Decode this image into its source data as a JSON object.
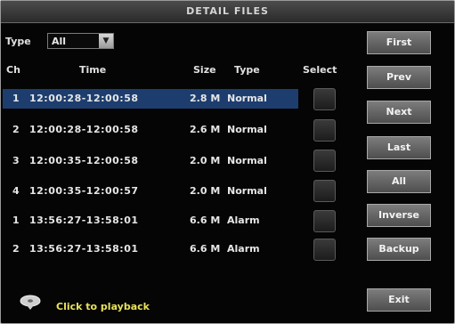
{
  "window": {
    "title": "DETAIL FILES"
  },
  "filter": {
    "type_label": "Type",
    "type_value": "All"
  },
  "table": {
    "headers": {
      "ch": "Ch",
      "time": "Time",
      "size": "Size",
      "type": "Type",
      "select": "Select"
    },
    "rows": [
      {
        "ch": "1",
        "time": "12:00:28-12:00:58",
        "size": "2.8 M",
        "type": "Normal",
        "selected": true
      },
      {
        "ch": "2",
        "time": "12:00:28-12:00:58",
        "size": "2.6 M",
        "type": "Normal",
        "selected": false
      },
      {
        "ch": "3",
        "time": "12:00:35-12:00:58",
        "size": "2.0 M",
        "type": "Normal",
        "selected": false
      },
      {
        "ch": "4",
        "time": "12:00:35-12:00:57",
        "size": "2.0 M",
        "type": "Normal",
        "selected": false
      },
      {
        "ch": "1",
        "time": "13:56:27-13:58:01",
        "size": "6.6 M",
        "type": "Alarm",
        "selected": false
      },
      {
        "ch": "2",
        "time": "13:56:27-13:58:01",
        "size": "6.6 M",
        "type": "Alarm",
        "selected": false
      }
    ]
  },
  "buttons": {
    "first": "First",
    "prev": "Prev",
    "next": "Next",
    "last": "Last",
    "all": "All",
    "inverse": "Inverse",
    "backup": "Backup",
    "exit": "Exit"
  },
  "footer": {
    "hint": "Click to playback",
    "icon": "playback-disc-icon"
  },
  "colors": {
    "selected_row": "#1d3d6e",
    "hint_text": "#e9e25a",
    "background": "#050505"
  }
}
